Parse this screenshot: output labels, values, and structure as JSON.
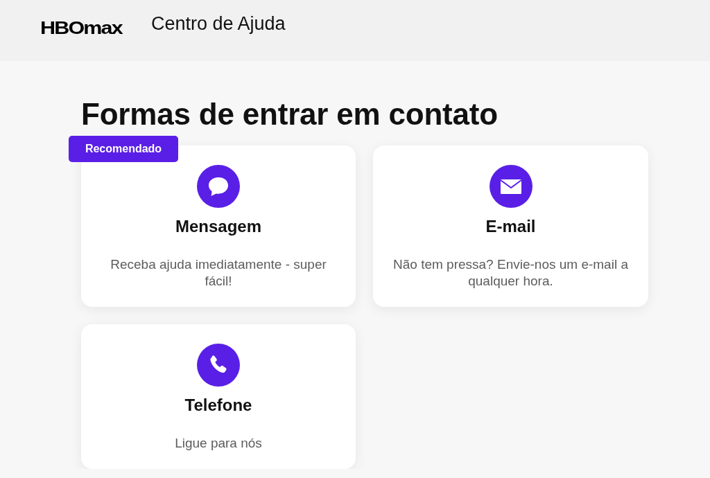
{
  "header": {
    "logo": "HBOmax",
    "title": "Centro de Ajuda"
  },
  "page": {
    "heading": "Formas de entrar em contato"
  },
  "options": [
    {
      "kind": "message",
      "badge": "Recomendado",
      "title": "Mensagem",
      "description": "Receba ajuda imediatamente - super fácil!"
    },
    {
      "kind": "email",
      "title": "E-mail",
      "description": "Não tem pressa? Envie-nos um e-mail a qualquer hora."
    },
    {
      "kind": "phone",
      "title": "Telefone",
      "description": "Ligue para nós"
    }
  ]
}
